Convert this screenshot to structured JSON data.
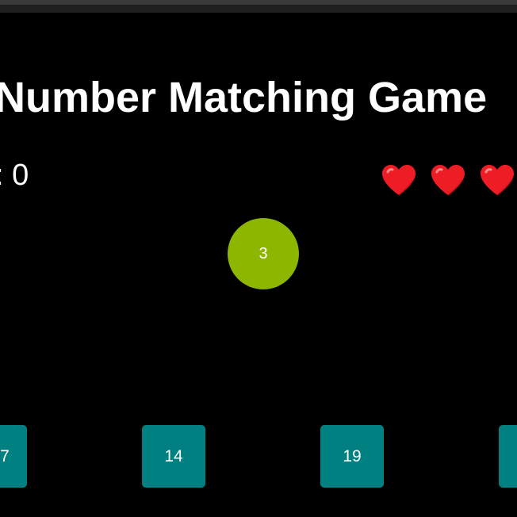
{
  "game": {
    "title": "Number Matching Game",
    "score_text": ": 0",
    "lives": 3,
    "target": {
      "number": "3",
      "color": "#8db600"
    },
    "tiles": [
      {
        "number": "7"
      },
      {
        "number": "14"
      },
      {
        "number": "19"
      },
      {
        "number": ""
      }
    ],
    "tile_color": "#008080",
    "heart_color": "#ee1c25",
    "icons": {
      "life": "heart-icon"
    }
  }
}
